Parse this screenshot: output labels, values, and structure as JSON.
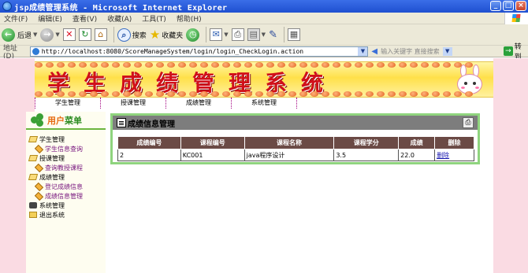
{
  "window": {
    "title": "jsp成绩管理系统 - Microsoft Internet Explorer",
    "minimize": "_",
    "maximize": "□",
    "close": "×"
  },
  "menubar": [
    "文件(F)",
    "编辑(E)",
    "查看(V)",
    "收藏(A)",
    "工具(T)",
    "帮助(H)"
  ],
  "toolbar": {
    "back": "后退",
    "search": "搜索",
    "favorites": "收藏夹"
  },
  "addressbar": {
    "label": "地址(D)",
    "url": "http://localhost:8080/ScoreManageSystem/login/login_CheckLogin.action",
    "search_hint": "输入关键字 直接搜索",
    "go": "转到"
  },
  "banner": {
    "title": "学生成绩管理系统"
  },
  "nav": [
    "学生管理",
    "授课管理",
    "成绩管理",
    "系统管理"
  ],
  "sidebar": {
    "title_a": "用户",
    "title_b": "菜单",
    "groups": [
      {
        "label": "学生管理",
        "children": [
          "学生信息查询"
        ]
      },
      {
        "label": "授课管理",
        "children": [
          "查询教授课程"
        ]
      },
      {
        "label": "成绩管理",
        "children": [
          "登记成绩信息",
          "成绩信息管理"
        ]
      },
      {
        "label": "系统管理",
        "children": []
      },
      {
        "label": "退出系统",
        "children": []
      }
    ]
  },
  "content": {
    "title": "成绩信息管理",
    "table": {
      "headers": [
        "成绩编号",
        "课程编号",
        "课程名称",
        "课程学分",
        "成绩",
        "删除"
      ],
      "rows": [
        [
          "2",
          "KC001",
          "java程序设计",
          "3.5",
          "22.0",
          "删除"
        ]
      ]
    }
  }
}
